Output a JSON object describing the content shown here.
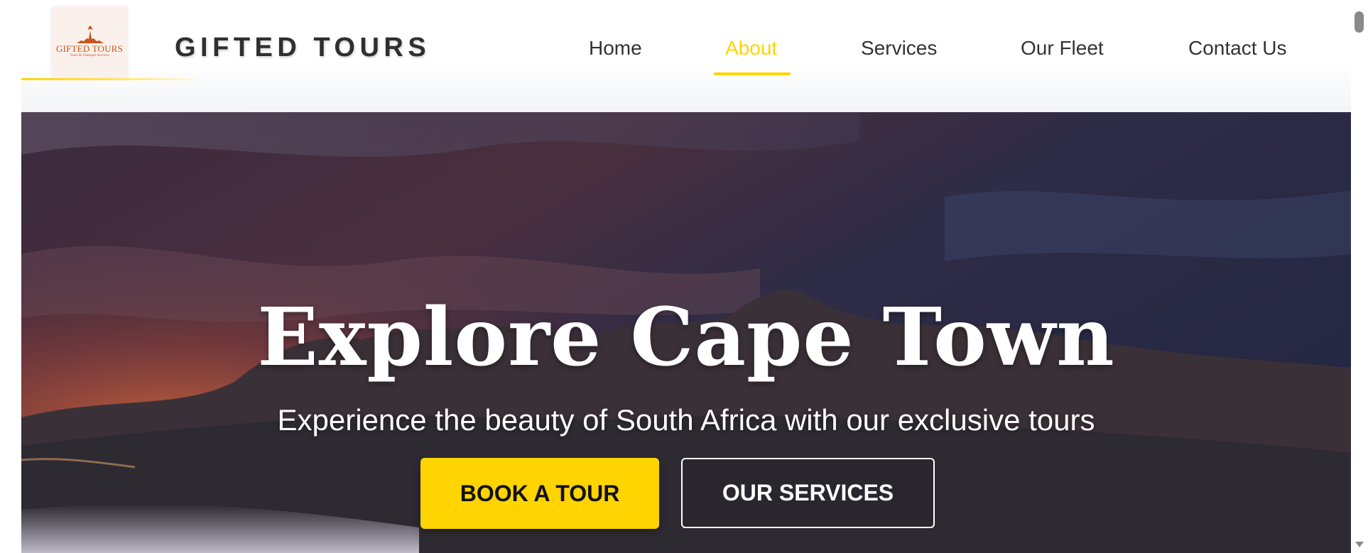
{
  "brand": {
    "logo_text": "GIFTED TOURS",
    "logo_tagline": "Tours & Transport Services",
    "name": "GIFTED TOURS"
  },
  "nav": {
    "items": [
      {
        "label": "Home",
        "active": false
      },
      {
        "label": "About",
        "active": true
      },
      {
        "label": "Services",
        "active": false
      },
      {
        "label": "Our Fleet",
        "active": false
      },
      {
        "label": "Contact Us",
        "active": false
      }
    ]
  },
  "hero": {
    "title": "Explore Cape Town",
    "subtitle": "Experience the beauty of South Africa with our exclusive tours",
    "primary_button": "BOOK A TOUR",
    "secondary_button": "OUR SERVICES"
  },
  "colors": {
    "accent": "#ffd400",
    "text_dark": "#333333",
    "logo": "#c8541c"
  },
  "icons": [
    "scroll-down-arrow-icon"
  ]
}
